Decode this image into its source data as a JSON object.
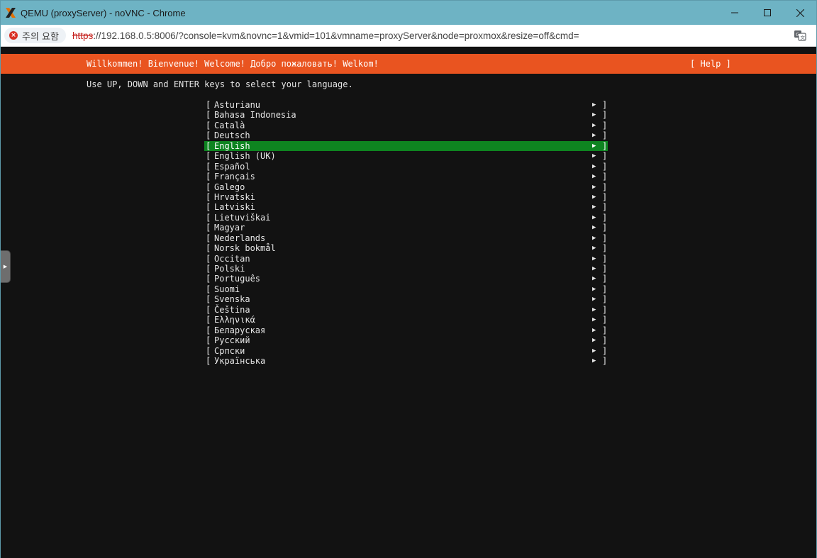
{
  "window": {
    "title": "QEMU (proxyServer) - noVNC - Chrome"
  },
  "address_bar": {
    "security_warning": "주의 요함",
    "url_scheme": "https",
    "url_rest": "://192.168.0.5:8006/?console=kvm&novnc=1&vmid=101&vmname=proxyServer&node=proxmox&resize=off&cmd="
  },
  "console": {
    "banner": "Willkommen! Bienvenue! Welcome! Добро пожаловать! Welkom!",
    "help_button": "[ Help ]",
    "instruction": "Use UP, DOWN and ENTER keys to select your language.",
    "selected_index": 4,
    "languages": [
      "Asturianu",
      "Bahasa Indonesia",
      "Català",
      "Deutsch",
      "English",
      "English (UK)",
      "Español",
      "Français",
      "Galego",
      "Hrvatski",
      "Latviski",
      "Lietuviškai",
      "Magyar",
      "Nederlands",
      "Norsk bokmål",
      "Occitan",
      "Polski",
      "Português",
      "Suomi",
      "Svenska",
      "Čeština",
      "Ελληνικά",
      "Беларуская",
      "Русский",
      "Српски",
      "Українська"
    ]
  },
  "colors": {
    "banner_bg": "#e95420",
    "selection_bg": "#0e8420",
    "console_bg": "#121212",
    "titlebar_bg": "#6eb3c4"
  }
}
